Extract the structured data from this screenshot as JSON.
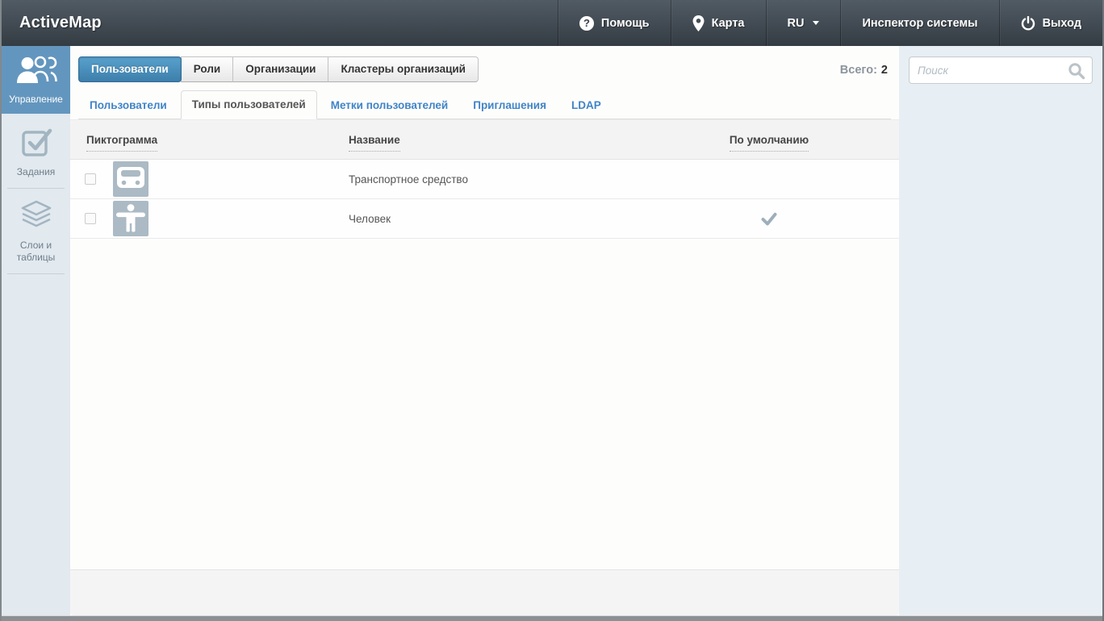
{
  "colors": {
    "topbar_top": "#515b64",
    "topbar_bottom": "#343c43",
    "accent_blue": "#4084c7",
    "active_tab_blue_top": "#58a1cd",
    "active_tab_blue_bottom": "#3d7fab",
    "sidebar_active_blue": "#6396be",
    "sidebar_bg": "#e2e9ef",
    "right_panel_bg": "#e8eff4",
    "tile_gray_blue": "#abbac4",
    "checkmark_gray": "#9dafbb",
    "table_header_bg": "#f3f3f3"
  },
  "header": {
    "brand": "ActiveMap",
    "menu": [
      {
        "label": "Помощь",
        "icon": "help-icon",
        "glyph": "?"
      },
      {
        "label": "Карта",
        "icon": "map-pin-icon"
      },
      {
        "label": "RU",
        "icon": "caret-down-icon"
      },
      {
        "label": "Инспектор системы"
      },
      {
        "label": "Выход",
        "icon": "power-icon"
      }
    ]
  },
  "sidebar": {
    "items": [
      {
        "label": "Управление",
        "icon": "users-group-icon",
        "active": true
      },
      {
        "label": "Задания",
        "icon": "checkbox-check-icon",
        "active": false
      },
      {
        "label": "Слои и таблицы",
        "icon": "layers-icon",
        "active": false
      }
    ]
  },
  "main": {
    "tabs": [
      {
        "label": "Пользователи",
        "active": true
      },
      {
        "label": "Роли",
        "active": false
      },
      {
        "label": "Организации",
        "active": false
      },
      {
        "label": "Кластеры организаций",
        "active": false
      }
    ],
    "total": {
      "label": "Всего:",
      "value": "2"
    },
    "subtabs": [
      {
        "label": "Пользователи",
        "active": false
      },
      {
        "label": "Типы пользователей",
        "active": true
      },
      {
        "label": "Метки пользователей",
        "active": false
      },
      {
        "label": "Приглашения",
        "active": false
      },
      {
        "label": "LDAP",
        "active": false
      }
    ],
    "table": {
      "columns": [
        "Пиктограмма",
        "Название",
        "По умолчанию"
      ],
      "rows": [
        {
          "icon": "vehicle-icon",
          "name": "Транспортное средство",
          "is_default": false
        },
        {
          "icon": "person-icon",
          "name": "Человек",
          "is_default": true
        }
      ]
    }
  },
  "search": {
    "placeholder": "Поиск"
  }
}
